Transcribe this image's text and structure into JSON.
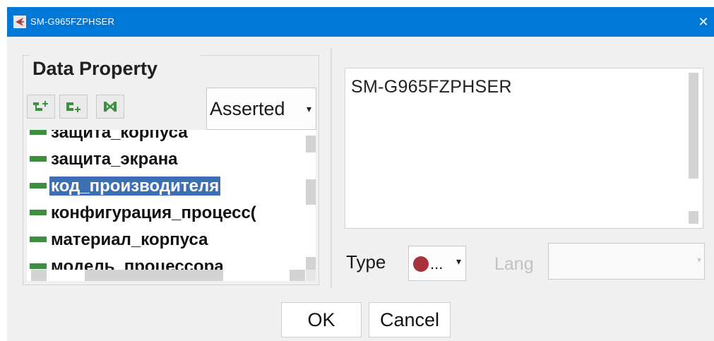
{
  "window": {
    "title": "SM-G965FZPHSER",
    "close_glyph": "✕"
  },
  "left_panel": {
    "heading": "Data Property",
    "toolbar": {
      "icons": [
        "add-subproperty-icon",
        "add-sibling-property-icon",
        "delete-property-icon"
      ]
    },
    "filter_select": {
      "value": "Asserted",
      "arrow": "▾"
    },
    "items": [
      {
        "label": "защита_корпуса",
        "selected": false
      },
      {
        "label": "защита_экрана",
        "selected": false
      },
      {
        "label": "код_производителя",
        "selected": true
      },
      {
        "label": "конфигурация_процесс(",
        "selected": false
      },
      {
        "label": "материал_корпуса",
        "selected": false
      },
      {
        "label": "модель_процессора",
        "selected": false
      }
    ]
  },
  "right_panel": {
    "value": "SM-G965FZPHSER",
    "type_label": "Type",
    "type_select": {
      "value": "...",
      "arrow": "▾",
      "dot_color": "#a8323a"
    },
    "lang_label": "Lang",
    "lang_value": "",
    "lang_arrow": "▾"
  },
  "buttons": {
    "ok": "OK",
    "cancel": "Cancel"
  },
  "colors": {
    "titlebar": "#0078d7",
    "selection": "#3d6fb5",
    "property_bar": "#3e8e40"
  }
}
